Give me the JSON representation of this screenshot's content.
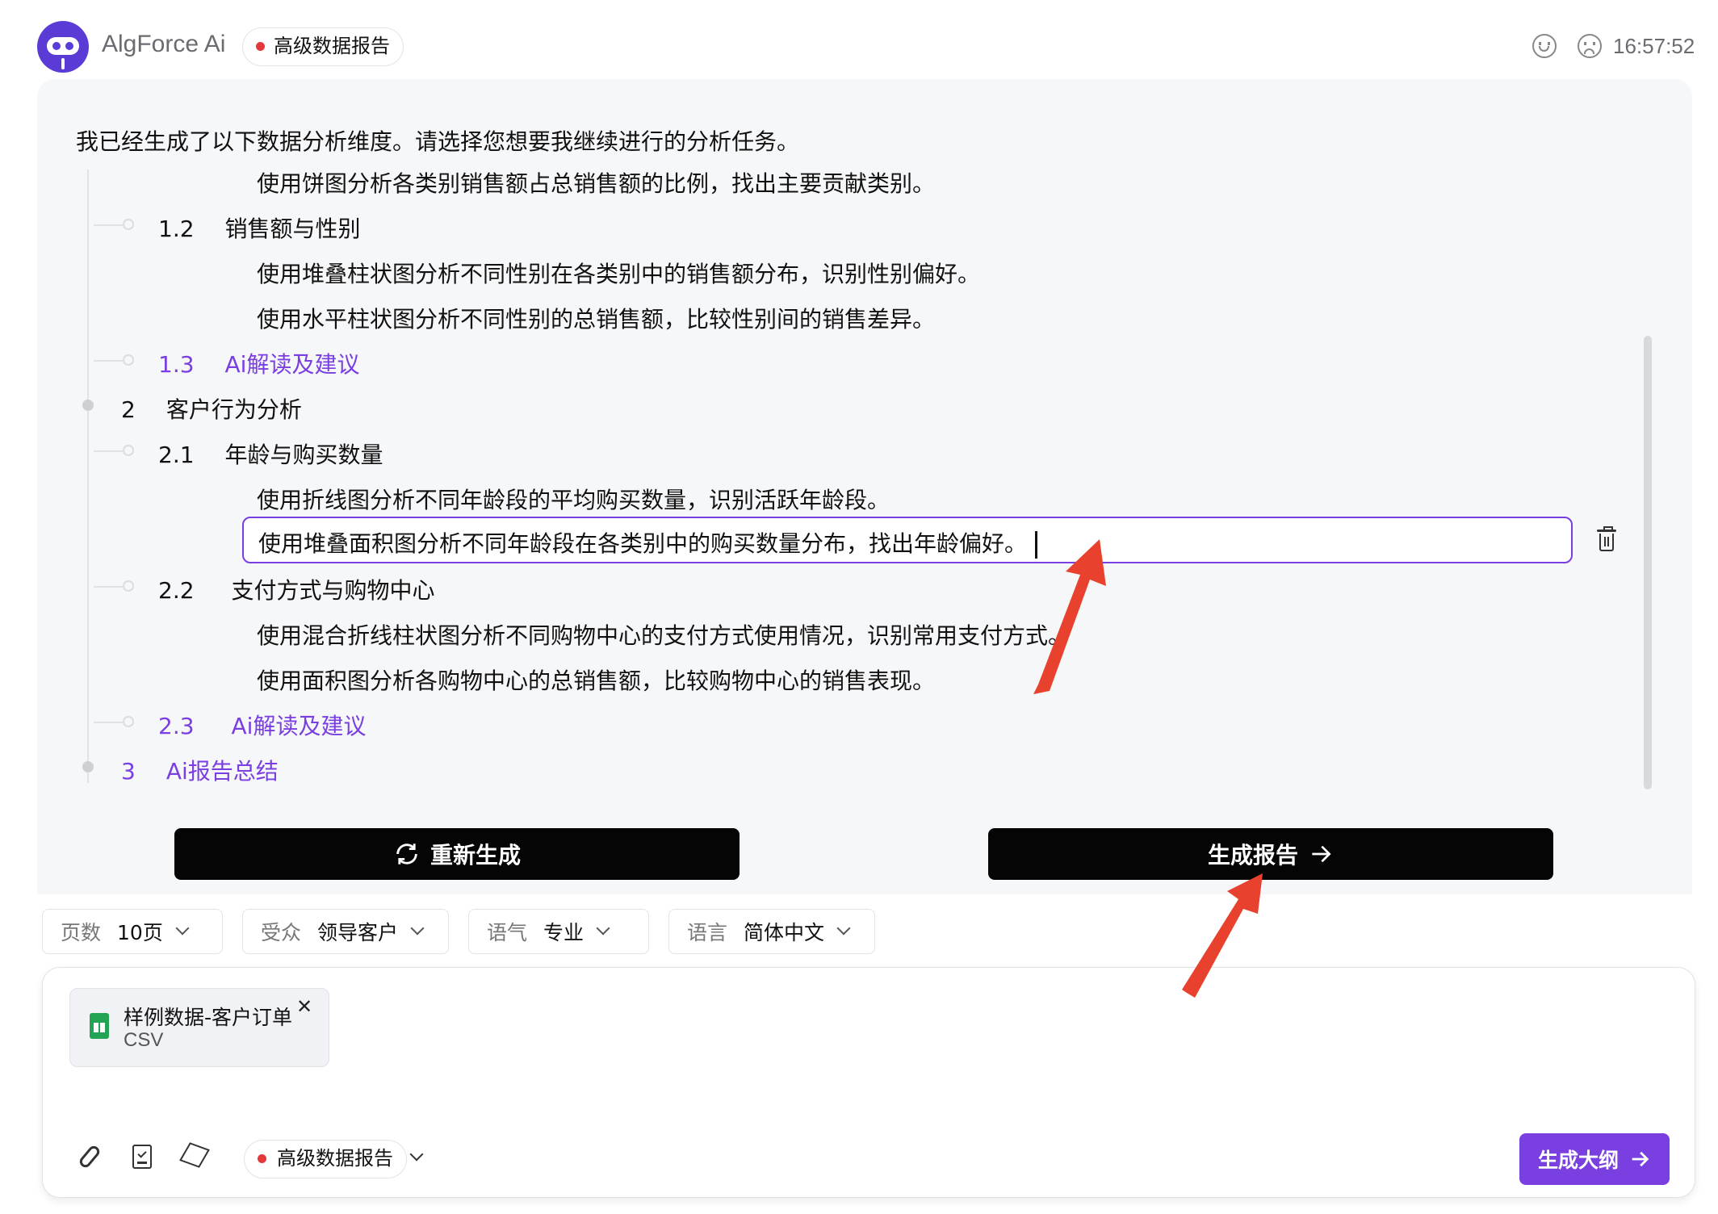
{
  "header": {
    "brand": "AlgForce Ai",
    "mode_pill": "高级数据报告",
    "time": "16:57:52",
    "icons": [
      "smile-icon",
      "frown-icon"
    ]
  },
  "panel": {
    "intro": "我已经生成了以下数据分析维度。请选择您想要我继续进行的分析任务。",
    "rows": {
      "r0_text": "使用饼图分析各类别销售额占总销售额的比例，找出主要贡献类别。",
      "s12_num": "1.2",
      "s12_title": "销售额与性别",
      "s12_a": "使用堆叠柱状图分析不同性别在各类别中的销售额分布，识别性别偏好。",
      "s12_b": "使用水平柱状图分析不同性别的总销售额，比较性别间的销售差异。",
      "s13_num": "1.3",
      "s13_title": "Ai解读及建议",
      "s2_num": "2",
      "s2_title": "客户行为分析",
      "s21_num": "2.1",
      "s21_title": "年龄与购买数量",
      "s21_a": "使用折线图分析不同年龄段的平均购买数量，识别活跃年龄段。",
      "s21_b_edit": "使用堆叠面积图分析不同年龄段在各类别中的购买数量分布，找出年龄偏好。",
      "s22_num": "2.2",
      "s22_title": "支付方式与购物中心",
      "s22_a": "使用混合折线柱状图分析不同购物中心的支付方式使用情况，识别常用支付方式。",
      "s22_b": "使用面积图分析各购物中心的总销售额，比较购物中心的销售表现。",
      "s23_num": "2.3",
      "s23_title": "Ai解读及建议",
      "s3_num": "3",
      "s3_title": "Ai报告总结"
    },
    "regenerate_label": "重新生成",
    "generate_report_label": "生成报告"
  },
  "options": {
    "pages_key": "页数",
    "pages_val": "10页",
    "audience_key": "受众",
    "audience_val": "领导客户",
    "tone_key": "语气",
    "tone_val": "专业",
    "language_key": "语言",
    "language_val": "简体中文"
  },
  "input": {
    "file_name": "样例数据-客户订单",
    "file_type": "CSV",
    "file_close": "✕",
    "mode_pill": "高级数据报告",
    "submit_label": "生成大纲"
  },
  "colors": {
    "accent": "#7a3fe0",
    "button_black": "#050505",
    "annotation_arrow": "#e8412e",
    "status_dot": "#e5383b"
  }
}
